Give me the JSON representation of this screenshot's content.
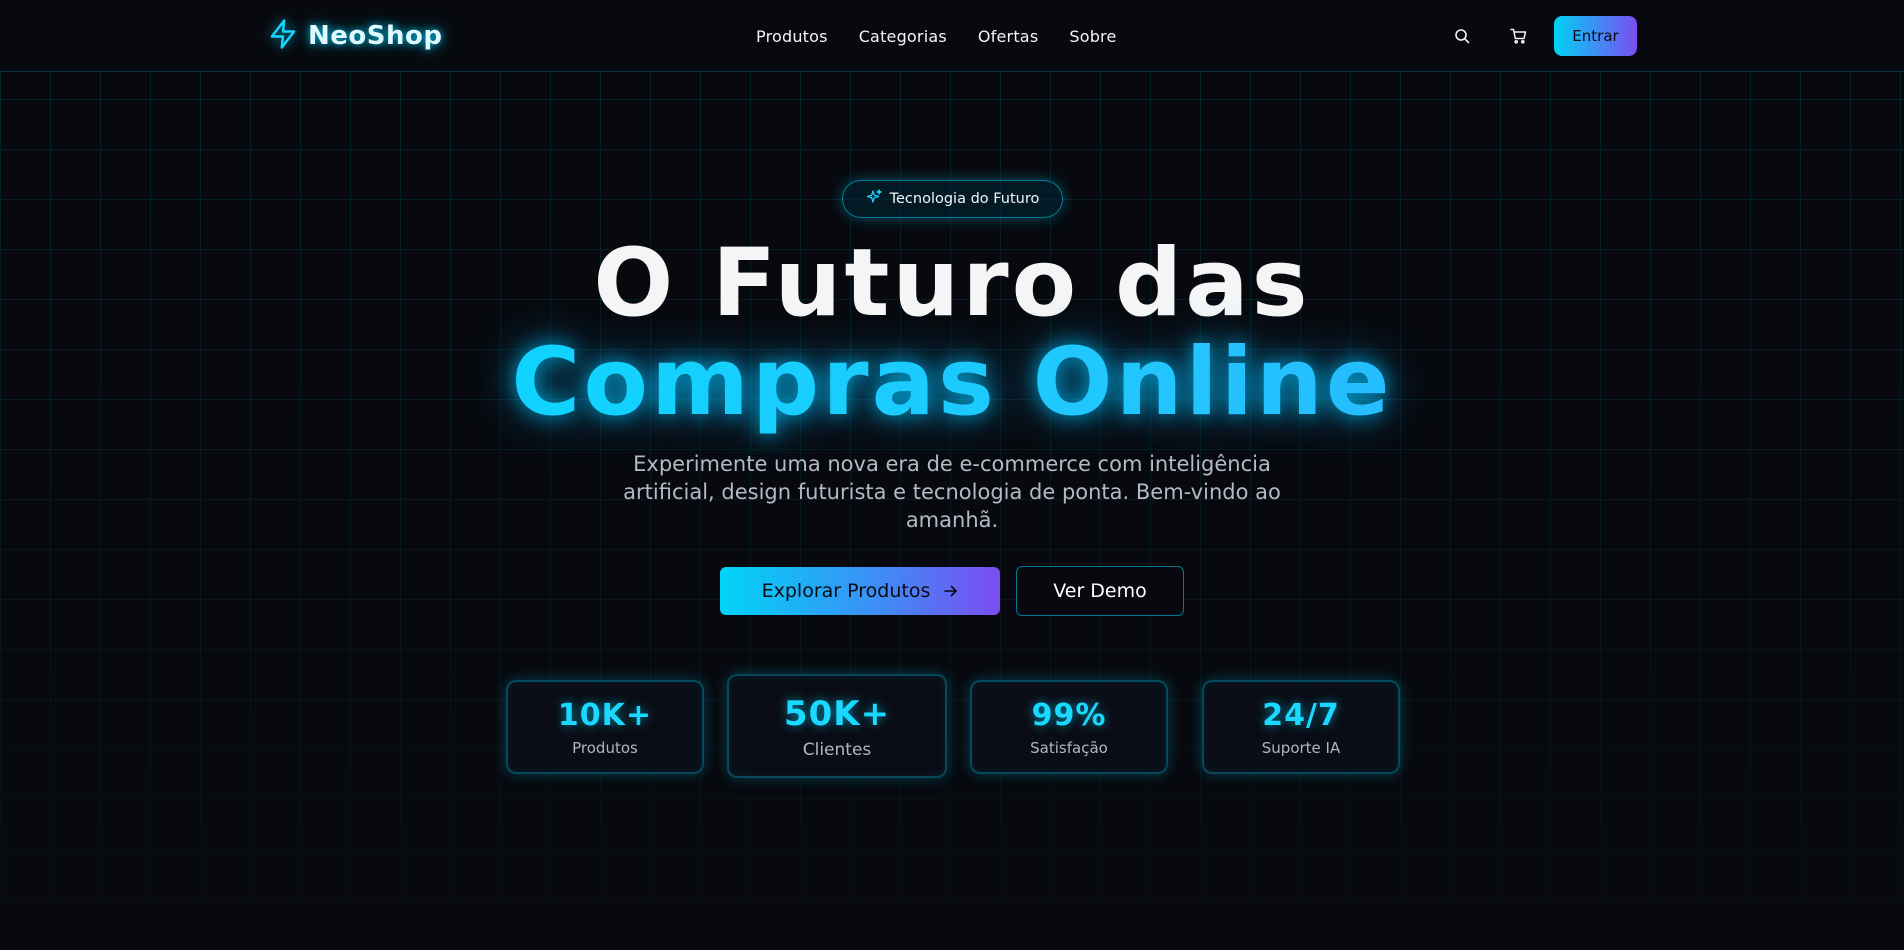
{
  "header": {
    "brand": "NeoShop",
    "nav": [
      "Produtos",
      "Categorias",
      "Ofertas",
      "Sobre"
    ],
    "login_label": "Entrar",
    "icons": [
      "lightning-bolt-icon",
      "search-icon",
      "cart-icon"
    ]
  },
  "hero": {
    "badge": "Tecnologia do Futuro",
    "title_line1": "O Futuro das",
    "title_line2": "Compras Online",
    "subtitle": "Experimente uma nova era de e-commerce com inteligência artificial, design futurista e tecnologia de ponta. Bem-vindo ao amanhã.",
    "primary_cta": "Explorar Produtos",
    "secondary_cta": "Ver Demo"
  },
  "stats": [
    {
      "value": "10K+",
      "label": "Produtos"
    },
    {
      "value": "50K+",
      "label": "Clientes"
    },
    {
      "value": "99%",
      "label": "Satisfação"
    },
    {
      "value": "24/7",
      "label": "Suporte IA"
    }
  ],
  "colors": {
    "background": "#07090e",
    "accent_cyan": "#00d4ff",
    "accent_purple": "#7b4df2",
    "grid_line": "#0e3a40"
  }
}
